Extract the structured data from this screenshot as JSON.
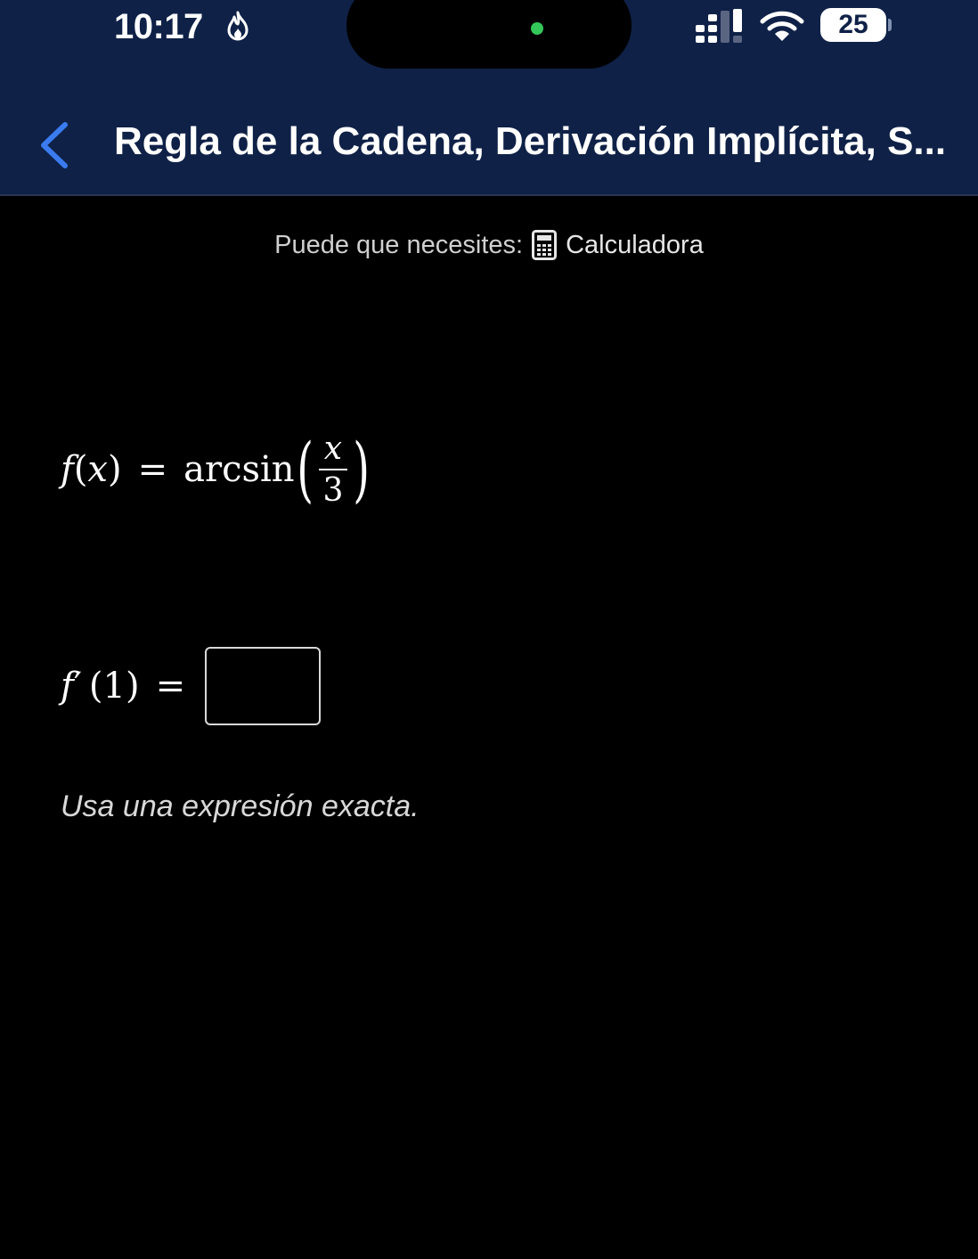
{
  "status_bar": {
    "time": "10:17",
    "battery_level": "25",
    "icons": [
      "fire-icon",
      "signal-icon",
      "wifi-icon",
      "battery-icon"
    ],
    "island_dot_color": "#34c759"
  },
  "header": {
    "title": "Regla de la Cadena, Derivación Implícita, S...",
    "background_color": "#0f2147",
    "back_icon_color": "#3a7bf0"
  },
  "hint": {
    "label": "Puede que necesites:",
    "calculator_label": "Calculadora"
  },
  "problem": {
    "function_name": "f",
    "variable": "x",
    "equals": "=",
    "operator": "arcsin",
    "numerator": "x",
    "denominator": "3",
    "answer_lhs_name": "f",
    "answer_prime": "′",
    "answer_arg": "1",
    "answer_value": "",
    "instruction": "Usa una expresión exacta."
  }
}
